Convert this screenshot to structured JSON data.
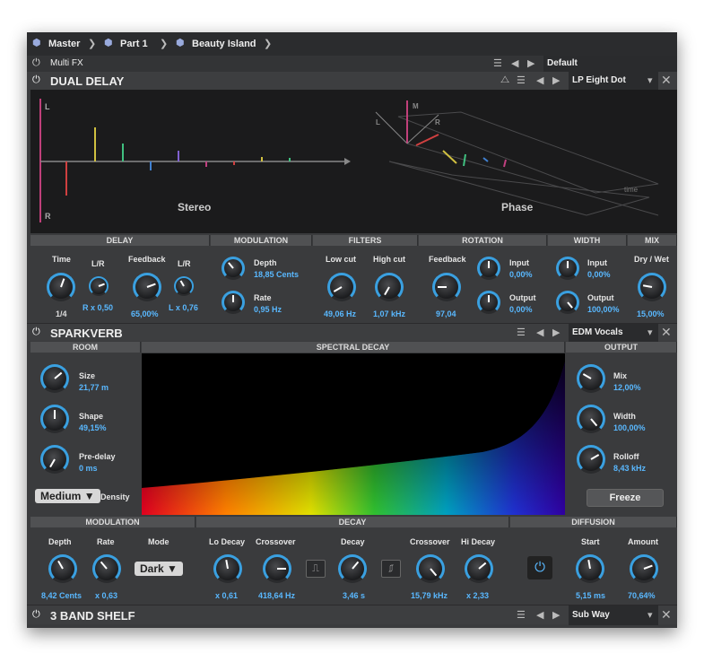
{
  "breadcrumb": {
    "items": [
      "Master",
      "Part 1",
      "Beauty Island"
    ]
  },
  "multifx": {
    "title": "Multi FX",
    "preset": "Default"
  },
  "dual_delay": {
    "title": "DUAL DELAY",
    "preset": "LP Eight Dot",
    "viz": {
      "stereo_label": "Stereo",
      "phase_label": "Phase",
      "l": "L",
      "r": "R",
      "m": "M",
      "time": "time"
    },
    "sections": {
      "delay": "DELAY",
      "modulation": "MODULATION",
      "filters": "FILTERS",
      "rotation": "ROTATION",
      "width": "WIDTH",
      "mix": "MIX"
    },
    "time": {
      "label": "Time",
      "value": "1/4"
    },
    "lr1": {
      "label": "L/R",
      "value": "R x 0,50"
    },
    "feedback": {
      "label": "Feedback",
      "value": "65,00%"
    },
    "lr2": {
      "label": "L/R",
      "value": "L x 0,76"
    },
    "depth": {
      "label": "Depth",
      "value": "18,85 Cents"
    },
    "rate": {
      "label": "Rate",
      "value": "0,95 Hz"
    },
    "lowcut": {
      "label": "Low cut",
      "value": "49,06 Hz"
    },
    "highcut": {
      "label": "High cut",
      "value": "1,07 kHz"
    },
    "rot_feedback": {
      "label": "Feedback",
      "value": "97,04"
    },
    "rot_input": {
      "label": "Input",
      "value": "0,00%"
    },
    "rot_output": {
      "label": "Output",
      "value": "0,00%"
    },
    "w_input": {
      "label": "Input",
      "value": "0,00%"
    },
    "w_output": {
      "label": "Output",
      "value": "100,00%"
    },
    "drywet": {
      "label": "Dry / Wet",
      "value": "15,00%"
    }
  },
  "sparkverb": {
    "title": "SPARKVERB",
    "preset": "EDM Vocals",
    "sections": {
      "room": "ROOM",
      "spectral": "SPECTRAL DECAY",
      "output": "OUTPUT",
      "modulation": "MODULATION",
      "decay": "DECAY",
      "diffusion": "DIFFUSION"
    },
    "size": {
      "label": "Size",
      "value": "21,77 m"
    },
    "shape": {
      "label": "Shape",
      "value": "49,15%"
    },
    "predelay": {
      "label": "Pre-delay",
      "value": "0 ms"
    },
    "density": {
      "selected": "Medium",
      "label": "Density"
    },
    "mix": {
      "label": "Mix",
      "value": "12,00%"
    },
    "width": {
      "label": "Width",
      "value": "100,00%"
    },
    "rolloff": {
      "label": "Rolloff",
      "value": "8,43 kHz"
    },
    "freeze": "Freeze",
    "mdepth": {
      "label": "Depth",
      "value": "8,42 Cents"
    },
    "mrate": {
      "label": "Rate",
      "value": "x 0,63"
    },
    "mode": {
      "label": "Mode",
      "selected": "Dark"
    },
    "lodecay": {
      "label": "Lo Decay",
      "value": "x 0,61"
    },
    "xover1": {
      "label": "Crossover",
      "value": "418,64 Hz"
    },
    "decay": {
      "label": "Decay",
      "value": "3,46 s"
    },
    "xover2": {
      "label": "Crossover",
      "value": "15,79 kHz"
    },
    "hidecay": {
      "label": "Hi Decay",
      "value": "x 2,33"
    },
    "start": {
      "label": "Start",
      "value": "5,15 ms"
    },
    "amount": {
      "label": "Amount",
      "value": "70,64%"
    }
  },
  "shelf": {
    "title": "3 BAND SHELF",
    "preset": "Sub Way"
  }
}
